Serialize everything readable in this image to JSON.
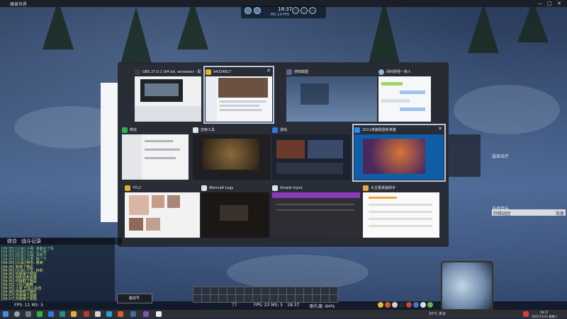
{
  "window": {
    "app_title": "魔兽世界",
    "controls": [
      "—",
      "□",
      "✕"
    ]
  },
  "hud": {
    "time": "18:37",
    "subtext": "MS 14 FPS"
  },
  "switcher": {
    "tiles": [
      {
        "label": "OBS 27.0.1 (64 bit, windows) - 配置文件: 未...",
        "icon_color": "#3a3f4a",
        "thumb": "obs"
      },
      {
        "label": "94334817",
        "icon_color": "#e0b12c",
        "thumb": "qq",
        "selected": true
      },
      {
        "label": "搜狗截图",
        "icon_color": "#5a6b8a",
        "thumb": "snow"
      },
      {
        "label": "闲时刷怪一族人",
        "icon_color": "#8db2e0",
        "thumb": "chatlist"
      },
      {
        "label": "微信",
        "icon_color": "#2bb24c",
        "thumb": "wechat"
      },
      {
        "label": "剪映工具",
        "icon_color": "#dde3ea",
        "thumb": "video"
      },
      {
        "label": "游戏",
        "icon_color": "#2c7be5",
        "thumb": "store"
      },
      {
        "label": "2021英雄联盟新英雄",
        "icon_color": "#1e90ff",
        "thumb": "lol"
      },
      {
        "label": "YYL2",
        "icon_color": "#e0b12c",
        "thumb": "people"
      },
      {
        "label": "Warcraft Logs",
        "icon_color": "#dde3ea",
        "thumb": "dark"
      },
      {
        "label": "Simple Input",
        "icon_color": "#dde3ea",
        "thumb": "purple"
      },
      {
        "label": "大主题桌面助手",
        "icon_color": "#f2a23a",
        "thumb": "settings"
      }
    ]
  },
  "right_panel": {
    "text1": "选择治疗",
    "text2": "选择目标",
    "bar_left": "狩猎战团",
    "bar_right": "恢复"
  },
  "chat": {
    "tabs": [
      "综合",
      "战斗记录"
    ],
    "lines": [
      {
        "text": "[09:35] [公会] 小明: 准备好了吗",
        "color": "#8fe28f"
      },
      {
        "text": "[09:35] [公会] 小红: 马上到",
        "color": "#8fe28f"
      },
      {
        "text": "[09:35] [队伍] 小刚: 开怪了",
        "color": "#8fe28f"
      },
      {
        "text": "[09:35] [公会] 小李: 等一下",
        "color": "#8fe28f"
      },
      {
        "text": "[09:35] [公会] 阿杰: 收到",
        "color": "#e3ff7a"
      },
      {
        "text": "[09:35] 获得了物品",
        "color": "#e3ff7a"
      },
      {
        "text": "[09:35] [公会] 小王: 好的",
        "color": "#e3ff7a"
      },
      {
        "text": "[09:35] 你获得了经验",
        "color": "#e3ff7a"
      },
      {
        "text": "[09:35] 你的任务完成",
        "color": "#e3ff7a"
      },
      {
        "text": "[09:35] 你拾取了物品",
        "color": "#e3ff7a"
      },
      {
        "text": "[09:35] 小队已解散",
        "color": "#e3ff7a"
      },
      {
        "text": "[09:35] 小张 已加入队伍",
        "color": "#e3ff7a"
      },
      {
        "text": "[09:36] 你收到了邮件",
        "color": "#e3ff7a"
      },
      {
        "text": "[09:37] 你获得了成就",
        "color": "#e3ff7a"
      },
      {
        "text": "[09:37] 你获得了奖励",
        "color": "#e3ff7a"
      }
    ]
  },
  "bottom": {
    "fps_left": "FPS: 11 MS: 5",
    "fps_mid": "FPS: 23 MS: 5",
    "time_mid": "18:37",
    "dur_mid": "耐久度: 84%",
    "ammo": "77"
  },
  "portrait": {
    "name": "集结号"
  },
  "taskbar": {
    "temp": "15°C 多云",
    "time": "18:37",
    "date": "2021/11/13 星期六"
  }
}
